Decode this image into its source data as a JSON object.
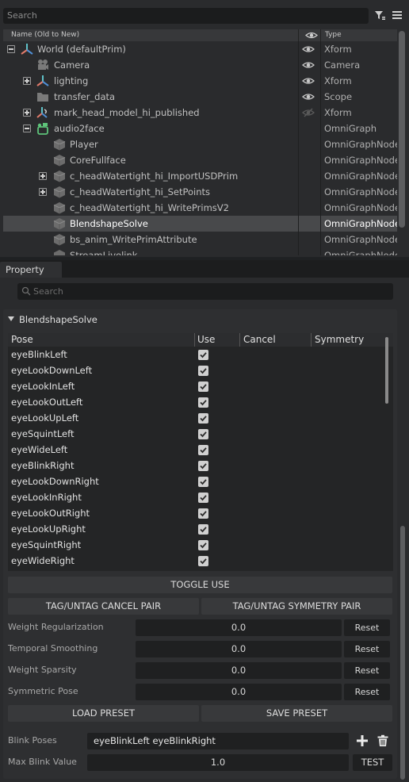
{
  "stage": {
    "search_placeholder": "Search",
    "columns": {
      "name": "Name (Old to New)",
      "type": "Type"
    },
    "rows": [
      {
        "name": "World (defaultPrim)",
        "type": "Xform"
      },
      {
        "name": "Camera",
        "type": "Camera"
      },
      {
        "name": "lighting",
        "type": "Xform"
      },
      {
        "name": "transfer_data",
        "type": "Scope"
      },
      {
        "name": "mark_head_model_hi_published",
        "type": "Xform"
      },
      {
        "name": "audio2face",
        "type": "OmniGraph"
      },
      {
        "name": "Player",
        "type": "OmniGraphNode"
      },
      {
        "name": "CoreFullface",
        "type": "OmniGraphNode"
      },
      {
        "name": "c_headWatertight_hi_ImportUSDPrim",
        "type": "OmniGraphNode"
      },
      {
        "name": "c_headWatertight_hi_SetPoints",
        "type": "OmniGraphNode"
      },
      {
        "name": "c_headWatertight_hi_WritePrimsV2",
        "type": "OmniGraphNode"
      },
      {
        "name": "BlendshapeSolve",
        "type": "OmniGraphNode"
      },
      {
        "name": "bs_anim_WritePrimAttribute",
        "type": "OmniGraphNode"
      },
      {
        "name": "StreamLivelink",
        "type": "OmniGraphNode"
      }
    ]
  },
  "property": {
    "tab": "Property",
    "search_placeholder": "Search",
    "section_title": "BlendshapeSolve",
    "table_headers": {
      "pose": "Pose",
      "use": "Use",
      "cancel": "Cancel",
      "symmetry": "Symmetry"
    },
    "poses": [
      "eyeBlinkLeft",
      "eyeLookDownLeft",
      "eyeLookInLeft",
      "eyeLookOutLeft",
      "eyeLookUpLeft",
      "eyeSquintLeft",
      "eyeWideLeft",
      "eyeBlinkRight",
      "eyeLookDownRight",
      "eyeLookInRight",
      "eyeLookOutRight",
      "eyeLookUpRight",
      "eyeSquintRight",
      "eyeWideRight"
    ],
    "toggle_use": "TOGGLE USE",
    "tag_cancel": "TAG/UNTAG CANCEL PAIR",
    "tag_symmetry": "TAG/UNTAG SYMMETRY PAIR",
    "params": [
      {
        "label": "Weight Regularization",
        "value": "0.0",
        "reset": "Reset"
      },
      {
        "label": "Temporal Smoothing",
        "value": "0.0",
        "reset": "Reset"
      },
      {
        "label": "Weight Sparsity",
        "value": "0.0",
        "reset": "Reset"
      },
      {
        "label": "Symmetric Pose",
        "value": "0.0",
        "reset": "Reset"
      }
    ],
    "load_preset": "LOAD PRESET",
    "save_preset": "SAVE PRESET",
    "blink_poses_label": "Blink Poses",
    "blink_poses_value": "eyeBlinkLeft eyeBlinkRight",
    "max_blink_label": "Max Blink Value",
    "max_blink_value": "1.0",
    "test": "TEST"
  }
}
